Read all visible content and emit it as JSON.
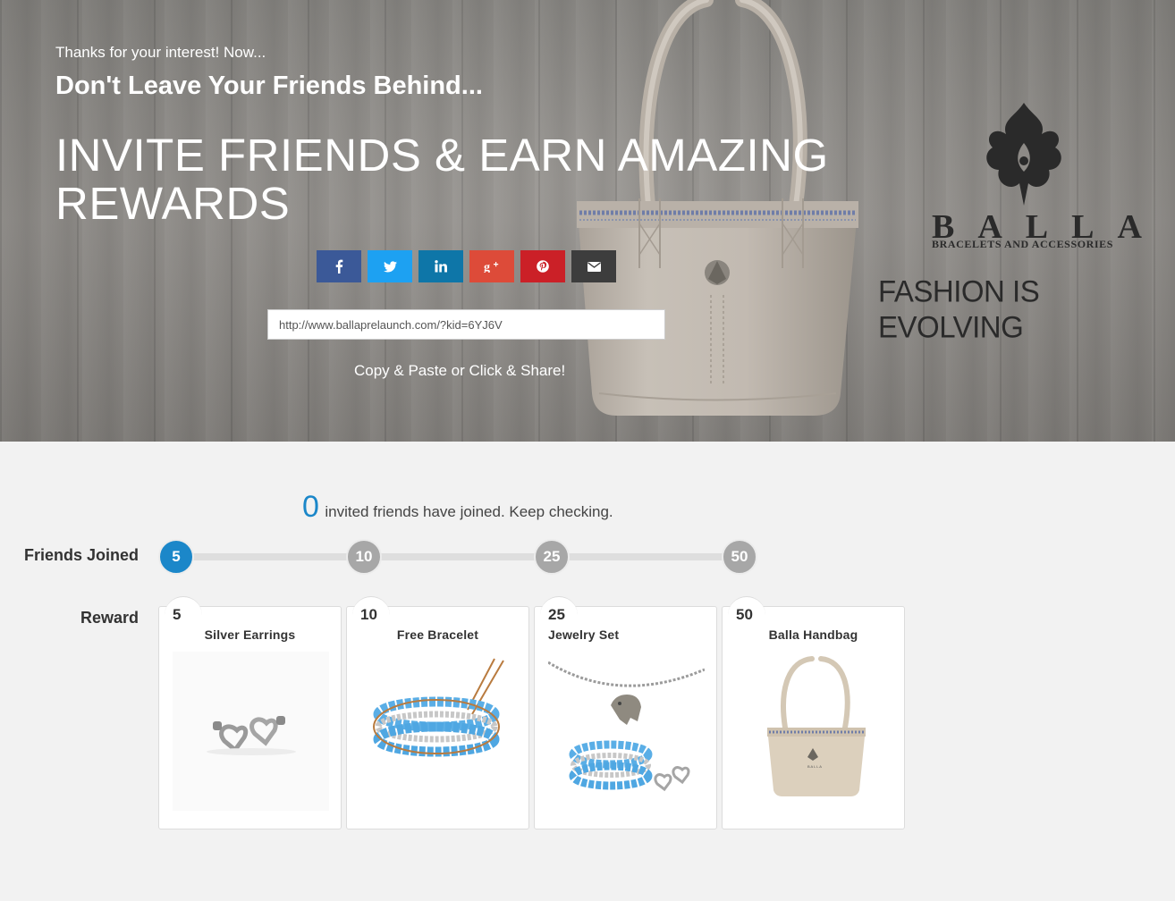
{
  "hero": {
    "pre_title": "Thanks for your interest! Now...",
    "sub_title": "Don't Leave Your Friends Behind...",
    "headline": "INVITE FRIENDS & EARN AMAZING REWARDS",
    "share_buttons": [
      {
        "network": "facebook",
        "icon": "facebook-icon",
        "color": "#3b5998"
      },
      {
        "network": "twitter",
        "icon": "twitter-icon",
        "color": "#1da1f2"
      },
      {
        "network": "linkedin",
        "icon": "linkedin-icon",
        "color": "#0e76a8"
      },
      {
        "network": "google-plus",
        "icon": "google-plus-icon",
        "color": "#dd4b39"
      },
      {
        "network": "pinterest",
        "icon": "pinterest-icon",
        "color": "#cb2027"
      },
      {
        "network": "email",
        "icon": "email-icon",
        "color": "#3d3d3d"
      }
    ],
    "referral_url": "http://www.ballaprelaunch.com/?kid=6YJ6V",
    "copy_hint": "Copy & Paste or Click & Share!"
  },
  "brand": {
    "name": "BALLA",
    "tagline": "BRACELETS AND ACCESSORIES",
    "slogan": "FASHION IS EVOLVING"
  },
  "progress": {
    "count": "0",
    "count_text": "invited friends have joined. Keep checking.",
    "friends_label": "Friends Joined",
    "reward_label": "Reward",
    "milestones": [
      "5",
      "10",
      "25",
      "50"
    ],
    "accent_color": "#1b87c9"
  },
  "rewards": [
    {
      "level": "5",
      "name": "Silver Earrings",
      "image": "earrings-image"
    },
    {
      "level": "10",
      "name": "Free Bracelet",
      "image": "bracelet-image"
    },
    {
      "level": "25",
      "name": "Jewelry Set",
      "image": "jewelry-set-image"
    },
    {
      "level": "50",
      "name": "Balla Handbag",
      "image": "handbag-image"
    }
  ]
}
